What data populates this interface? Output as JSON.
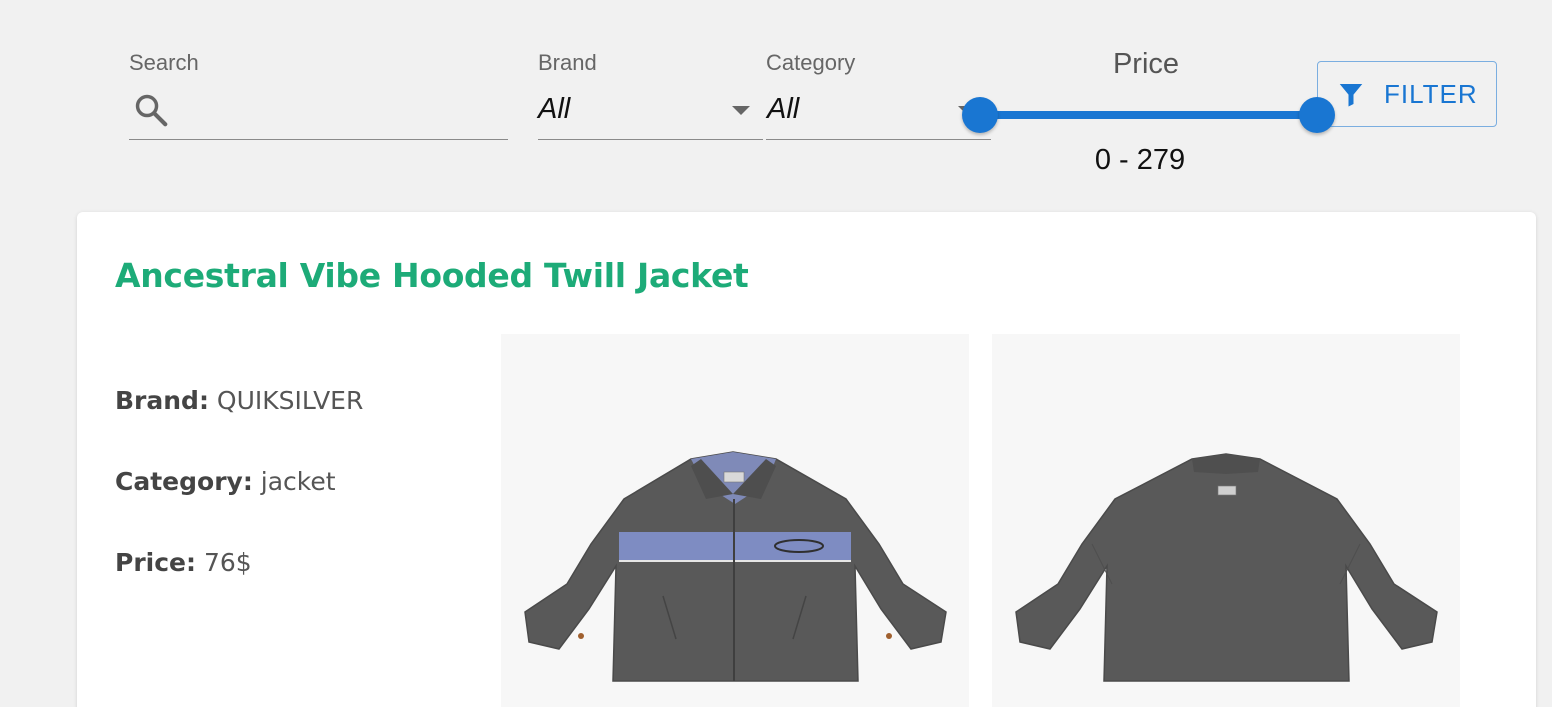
{
  "filters": {
    "search": {
      "label": "Search",
      "value": "",
      "icon": "search-icon"
    },
    "brand": {
      "label": "Brand",
      "selected": "All"
    },
    "category": {
      "label": "Category",
      "selected": "All"
    },
    "price": {
      "label": "Price",
      "min": 0,
      "max": 279,
      "range_text": "0 - 279"
    },
    "filter_button": {
      "label": "FILTER",
      "icon": "filter-icon"
    }
  },
  "product": {
    "title": "Ancestral Vibe Hooded Twill Jacket",
    "brand_label": "Brand:",
    "brand": "QUIKSILVER",
    "category_label": "Category:",
    "category": "jacket",
    "price_label": "Price:",
    "price": "76$",
    "images": [
      "front-view",
      "back-view"
    ]
  },
  "colors": {
    "accent": "#1976d2",
    "title": "#1dab78",
    "background": "#f1f1f1",
    "card": "#ffffff",
    "jacket": "#555555",
    "stripe": "#7e8cc2"
  }
}
